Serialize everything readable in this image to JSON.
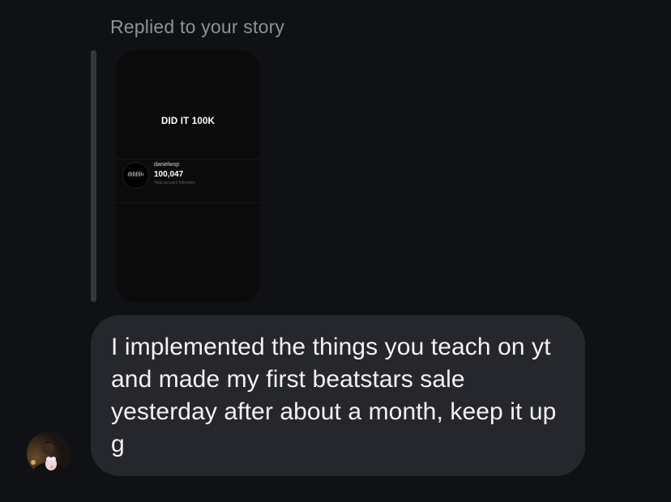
{
  "thread": {
    "reply_header": "Replied to your story"
  },
  "story": {
    "title": "DID IT 100K",
    "account_username": "danielwsp",
    "follower_count": "100,047",
    "caption": "Total account followers",
    "avatar_icon": "profile-logo-icon"
  },
  "message": {
    "text": "I implemented the things you teach on yt and made my first beatstars sale yesterday after about a month, keep it up g"
  },
  "sender": {
    "avatar_icon": "user-avatar-photo"
  },
  "colors": {
    "background": "#0f1115",
    "bubble": "#25272c",
    "muted_text": "#8e9199",
    "quote_bar": "#35373d",
    "story_card": "#0b0b0b"
  }
}
